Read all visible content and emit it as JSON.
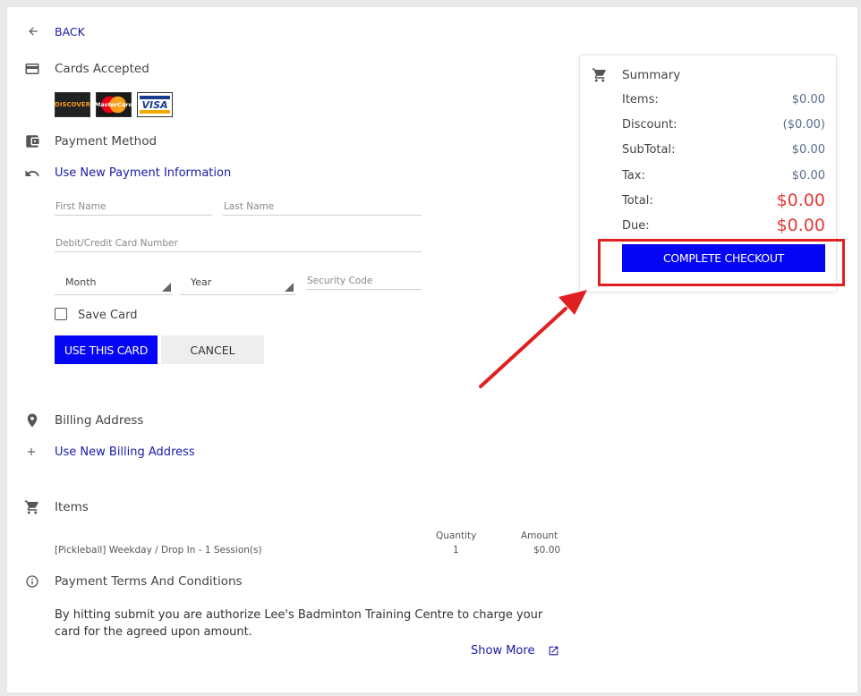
{
  "back_label": "BACK",
  "cards": {
    "title": "Cards Accepted",
    "logos": [
      {
        "name": "DISCOVER",
        "bg": "#222222",
        "fg": "#f29a1c"
      },
      {
        "name": "MasterCard",
        "bg": "#1a1a1a",
        "fg": "#ffffff"
      },
      {
        "name": "VISA",
        "bg": "#ffffff",
        "fg": "#1a3b8f"
      }
    ]
  },
  "payment": {
    "title": "Payment Method",
    "use_new": "Use New Payment Information",
    "first_name_placeholder": "First Name",
    "last_name_placeholder": "Last Name",
    "card_number_placeholder": "Debit/Credit Card Number",
    "month_label": "Month",
    "year_label": "Year",
    "security_code_placeholder": "Security Code",
    "save_card_label": "Save Card",
    "use_card_button": "USE THIS CARD",
    "cancel_button": "CANCEL"
  },
  "billing": {
    "title": "Billing Address",
    "use_new": "Use New Billing Address"
  },
  "items": {
    "title": "Items",
    "col_quantity": "Quantity",
    "col_amount": "Amount",
    "rows": [
      {
        "name": "[Pickleball] Weekday / Drop In - 1 Session(s)",
        "quantity": "1",
        "amount": "$0.00"
      }
    ]
  },
  "terms": {
    "title": "Payment Terms And Conditions",
    "text": "By hitting submit you are authorize Lee's Badminton Training Centre to charge your card for the agreed upon amount.",
    "show_more": "Show More"
  },
  "summary": {
    "title": "Summary",
    "items_label": "Items:",
    "items_value": "$0.00",
    "discount_label": "Discount:",
    "discount_value": "($0.00)",
    "subtotal_label": "SubTotal:",
    "subtotal_value": "$0.00",
    "tax_label": "Tax:",
    "tax_value": "$0.00",
    "total_label": "Total:",
    "total_value": "$0.00",
    "due_label": "Due:",
    "due_value": "$0.00",
    "checkout_button": "COMPLETE CHECKOUT"
  },
  "colors": {
    "primary": "#0505f5",
    "link": "#1a1aa6",
    "total_red": "#e53935",
    "annotation_red": "#e02020"
  }
}
